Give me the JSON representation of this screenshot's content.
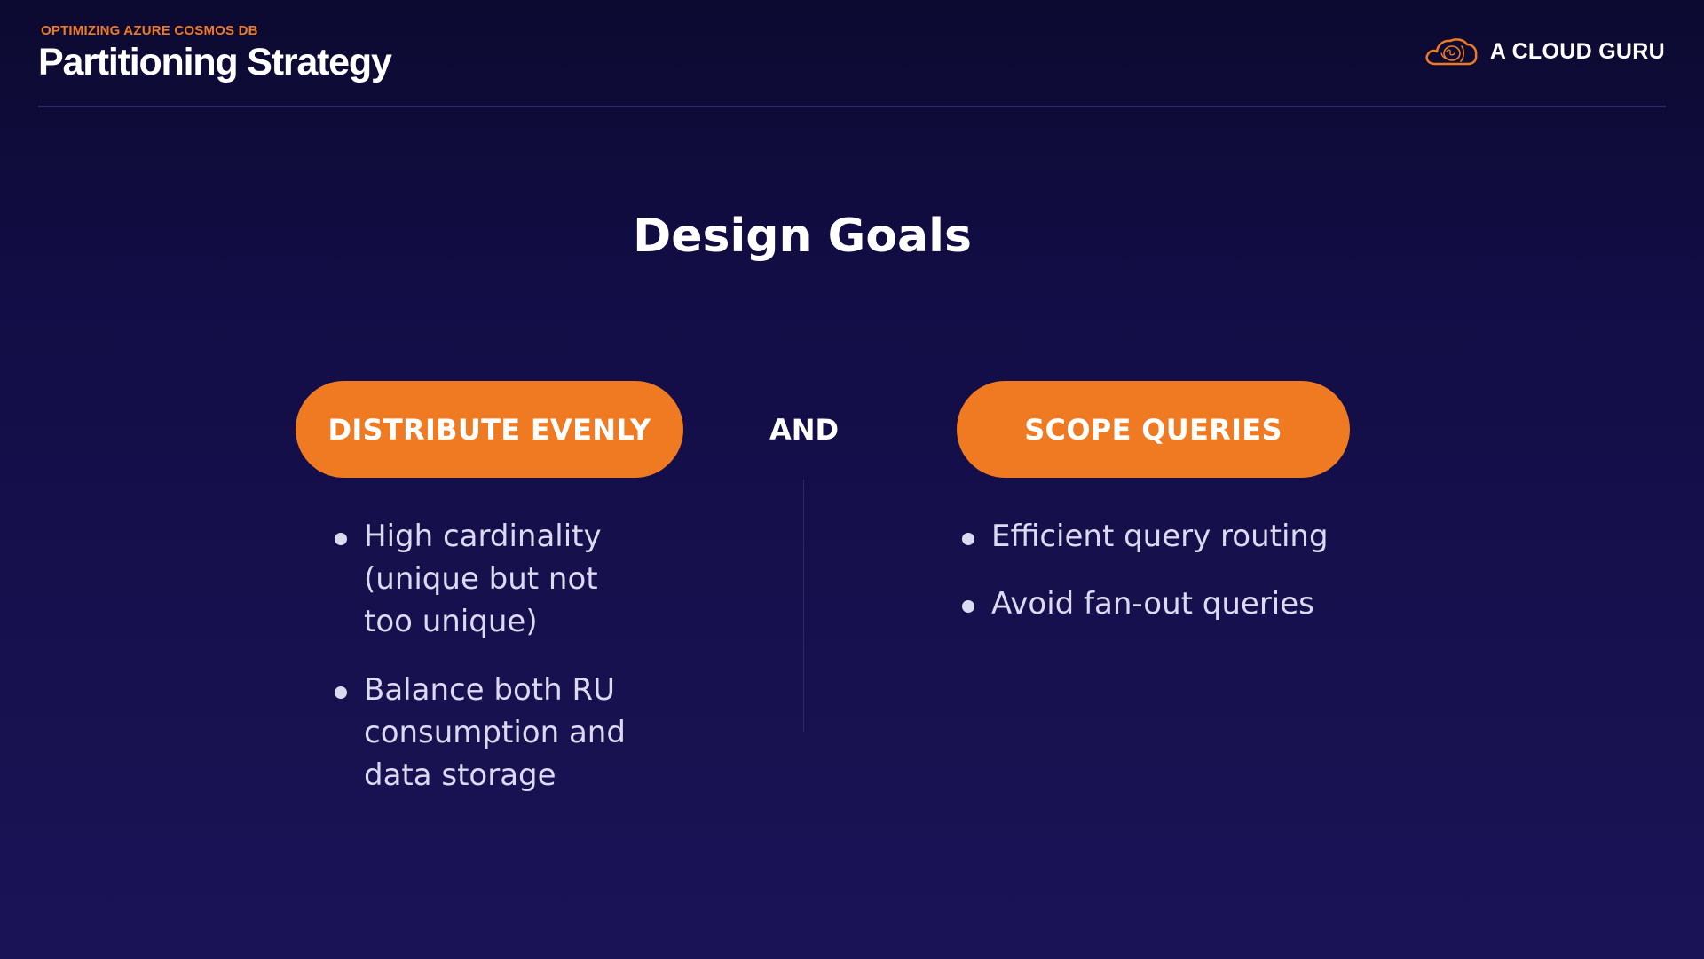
{
  "header": {
    "eyebrow": "OPTIMIZING AZURE COSMOS DB",
    "title": "Partitioning Strategy"
  },
  "brand": {
    "name": "A CLOUD GURU",
    "icon": "cloud-logo-icon"
  },
  "section": {
    "title": "Design Goals"
  },
  "goals": {
    "left": {
      "label": "DISTRIBUTE EVENLY",
      "bullets": [
        "High cardinality (unique but not too unique)",
        "Balance both RU consumption and data storage"
      ]
    },
    "connector": "AND",
    "right": {
      "label": "SCOPE QUERIES",
      "bullets": [
        "Efficient query routing",
        "Avoid fan-out queries"
      ]
    }
  },
  "colors": {
    "accent": "#ef7a22",
    "background_top": "#0c0a30",
    "background_bottom": "#1a1356",
    "text": "#ffffff",
    "bullet_text": "#dcdaf0"
  }
}
